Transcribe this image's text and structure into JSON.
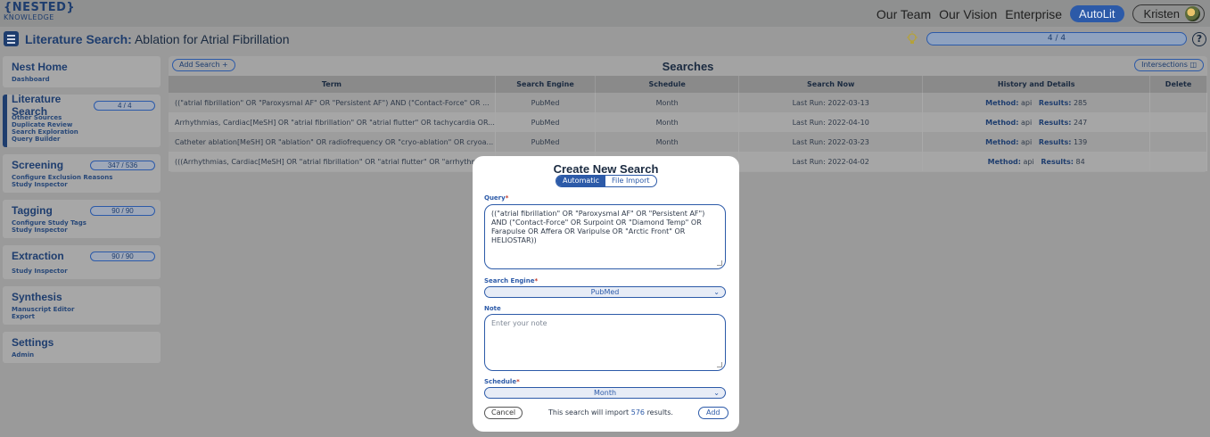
{
  "app": {
    "logo_line1": "{NESTED}",
    "logo_line2": "KNOWLEDGE"
  },
  "topnav": {
    "links": [
      "Our Team",
      "Our Vision",
      "Enterprise"
    ],
    "autolit": "AutoLit",
    "user": "Kristen"
  },
  "titlebar": {
    "section": "Literature Search:",
    "project": "Ablation for Atrial Fibrillation",
    "progress": "4 / 4"
  },
  "sidebar": {
    "items": [
      {
        "label": "Nest Home",
        "badge": "",
        "subs": [
          "Dashboard"
        ]
      },
      {
        "label": "Literature Search",
        "badge": "4 / 4",
        "subs": [
          "Other Sources",
          "Duplicate Review",
          "Search Exploration",
          "Query Builder"
        ]
      },
      {
        "label": "Screening",
        "badge": "347 / 536",
        "subs": [
          "Configure Exclusion Reasons",
          "Study Inspector"
        ]
      },
      {
        "label": "Tagging",
        "badge": "90 / 90",
        "subs": [
          "Configure Study Tags",
          "Study Inspector"
        ]
      },
      {
        "label": "Extraction",
        "badge": "90 / 90",
        "subs": [
          "Study Inspector"
        ]
      },
      {
        "label": "Synthesis",
        "badge": "",
        "subs": [
          "Manuscript Editor",
          "Export"
        ]
      },
      {
        "label": "Settings",
        "badge": "",
        "subs": [
          "Admin"
        ]
      }
    ]
  },
  "searches": {
    "add_label": "Add Search  +",
    "title": "Searches",
    "intersections_label": "Intersections",
    "columns": [
      "Term",
      "Search Engine",
      "Schedule",
      "Search Now",
      "History and Details",
      "Delete"
    ],
    "method_label": "Method:",
    "results_label": "Results:",
    "rows": [
      {
        "term": "((\"atrial fibrillation\" OR \"Paroxysmal AF\" OR \"Persistent AF\") AND (\"Contact-Force\" OR ...",
        "engine": "PubMed",
        "schedule": "Month",
        "last_run": "Last Run: 2022-03-13",
        "method": "api",
        "results": "285"
      },
      {
        "term": "Arrhythmias, Cardiac[MeSH] OR \"atrial fibrillation\" OR \"atrial flutter\" OR tachycardia OR...",
        "engine": "PubMed",
        "schedule": "Month",
        "last_run": "Last Run: 2022-04-10",
        "method": "api",
        "results": "247"
      },
      {
        "term": "Catheter ablation[MeSH] OR \"ablation\" OR radiofrequency OR \"cryo-ablation\" OR cryoa...",
        "engine": "PubMed",
        "schedule": "Month",
        "last_run": "Last Run: 2022-03-23",
        "method": "api",
        "results": "139"
      },
      {
        "term": "(((Arrhythmias, Cardiac[MeSH] OR \"atrial fibrillation\" OR \"atrial flutter\" OR \"arrhythmia\"...",
        "engine": "PubMed",
        "schedule": "Month",
        "last_run": "Last Run: 2022-04-02",
        "method": "api",
        "results": "84"
      }
    ]
  },
  "modal": {
    "title": "Create New Search",
    "tab_automatic": "Automatic",
    "tab_file_import": "File Import",
    "query_label": "Query",
    "query_value": "((\"atrial fibrillation\" OR \"Paroxysmal AF\" OR \"Persistent AF\") AND (\"Contact-Force\" OR Surpoint OR \"Diamond Temp\" OR Farapulse OR Affera OR Varipulse OR \"Arctic Front\" OR HELIOSTAR))",
    "engine_label": "Search Engine",
    "engine_value": "PubMed",
    "note_label": "Note",
    "note_placeholder": "Enter your note",
    "schedule_label": "Schedule",
    "schedule_value": "Month",
    "cancel_label": "Cancel",
    "import_text_pre": "This search will import",
    "import_count": "576",
    "import_text_post": "results.",
    "add_label": "Add",
    "required_mark": "*"
  },
  "icons": {
    "menu": "hamburger-icon",
    "bulb": "lightbulb-icon",
    "help": "question-mark-icon",
    "chevron": "chevron-down-icon",
    "intersections": "venn-icon"
  },
  "colors": {
    "brand": "#1e3d6e",
    "accent": "#2c5aa8"
  }
}
